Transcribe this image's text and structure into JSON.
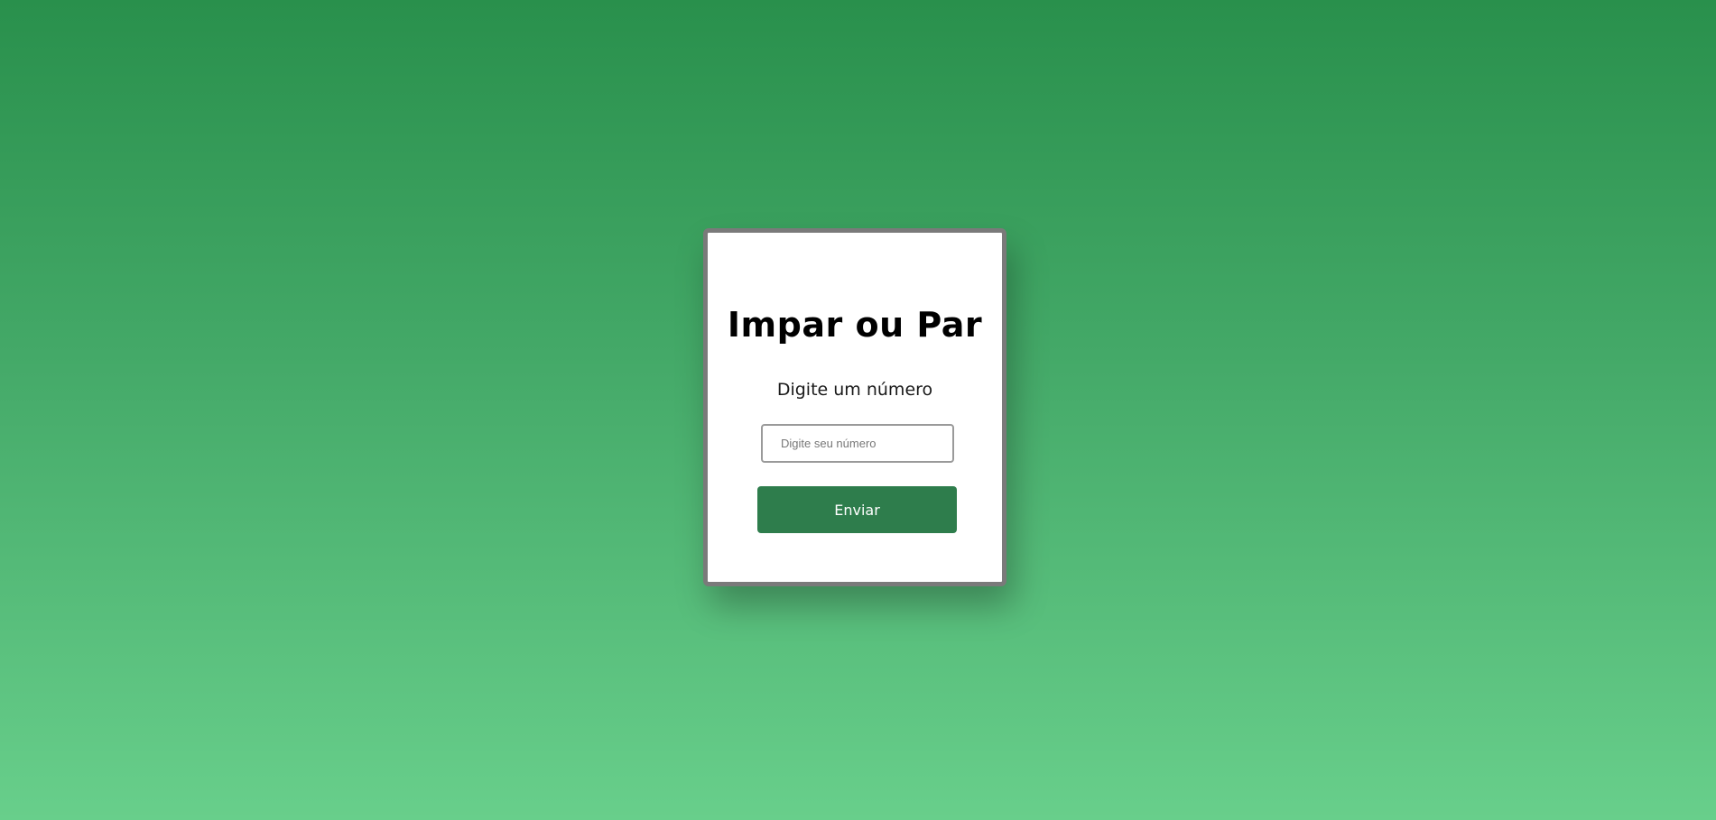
{
  "card": {
    "title": "Impar ou Par",
    "subtitle": "Digite um número",
    "input": {
      "value": "",
      "placeholder": "Digite seu número"
    },
    "submit_label": "Enviar"
  },
  "colors": {
    "background_top": "#29904c",
    "background_bottom": "#68cf8b",
    "card_border": "#7a7a7a",
    "button": "#2e7d4c"
  }
}
